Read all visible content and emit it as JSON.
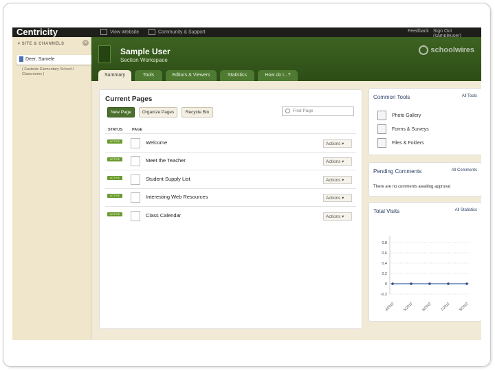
{
  "topbar": {
    "brand": "Centricity",
    "link_view_website": "View Website",
    "link_community": "Community & Support",
    "link_feedback": "Feedback",
    "link_signout": "Sign Out (sampleuser)"
  },
  "sidebar": {
    "heading": "▾ SITE & CHANNELS",
    "close": "×",
    "selected_item": "Deer, Samele",
    "sub_text": "( Eastside Elementary School / Classrooms )"
  },
  "header": {
    "user_name": "Sample User",
    "user_subtitle": "Section Workspace",
    "logo": "schoolwires",
    "tabs": [
      "Summary",
      "Tools",
      "Editors & Viewers",
      "Statistics",
      "How do I...?"
    ]
  },
  "current_pages": {
    "title": "Current Pages",
    "buttons": {
      "new_page": "New Page",
      "organize": "Organize Pages",
      "recycle": "Recycle Bin"
    },
    "search_placeholder": "Find Page",
    "col_status": "STATUS",
    "col_page": "PAGE",
    "rows": [
      {
        "status": "ACTIVE",
        "title": "Welcome",
        "action": "Actions ▾"
      },
      {
        "status": "ACTIVE",
        "title": "Meet the Teacher",
        "action": "Actions ▾"
      },
      {
        "status": "ACTIVE",
        "title": "Student Supply List",
        "action": "Actions ▾"
      },
      {
        "status": "ACTIVE",
        "title": "Interesting Web Resources",
        "action": "Actions ▾"
      },
      {
        "status": "ACTIVE",
        "title": "Class Calendar",
        "action": "Actions ▾"
      }
    ]
  },
  "common_tools": {
    "title": "Common Tools",
    "link": "All Tools",
    "items": [
      "Photo Gallery",
      "Forms & Surveys",
      "Files & Folders"
    ]
  },
  "pending_comments": {
    "title": "Pending Comments",
    "link": "All Comments",
    "text": "There are no comments awaiting approval"
  },
  "total_visits": {
    "title": "Total Visits",
    "link": "All Statistics"
  },
  "chart_data": {
    "type": "line",
    "x": [
      "4/2012",
      "5/2012",
      "6/2012",
      "7/2012",
      "8/2012"
    ],
    "values": [
      0,
      0,
      0,
      0,
      0
    ],
    "ylim": [
      -0.2,
      0.8
    ],
    "yticks": [
      0.8,
      0.6,
      0.4,
      0.2,
      0,
      -0.2
    ],
    "ytick_labels": [
      "0.8",
      "0.6",
      "0.4",
      "0.2",
      "0",
      "-0.2"
    ],
    "grid": true,
    "color": "#3c6aa8"
  }
}
